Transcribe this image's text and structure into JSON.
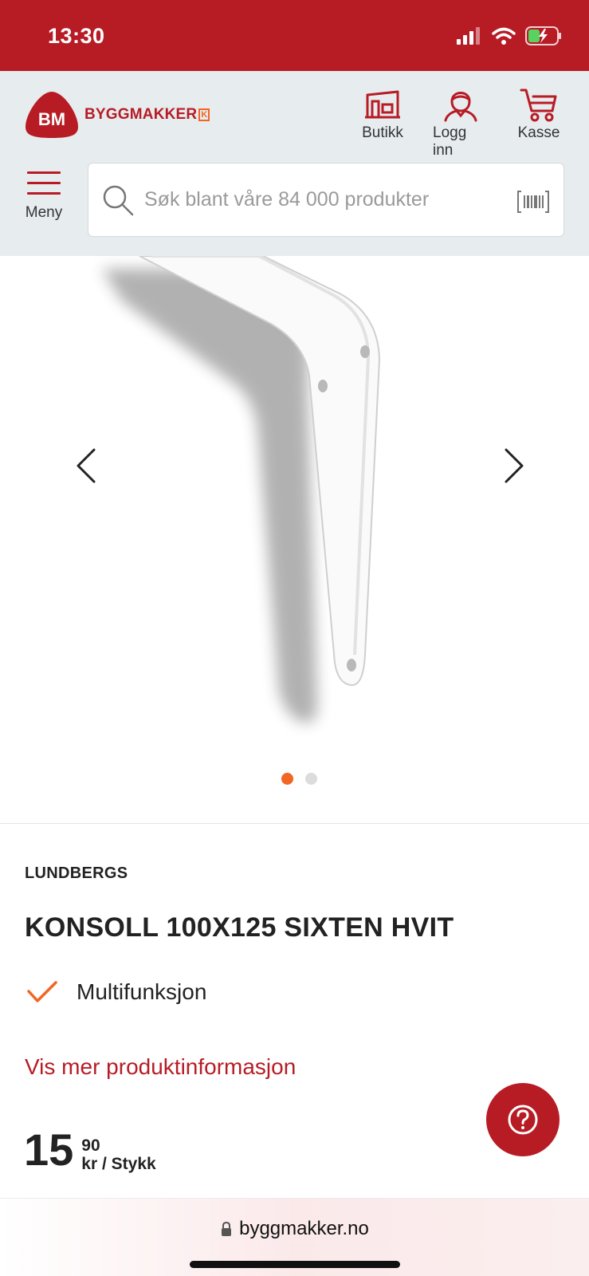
{
  "status_bar": {
    "time": "13:30"
  },
  "header": {
    "logo": {
      "badge": "BM",
      "text": "BYGGMAKKER",
      "suffix": "K"
    },
    "nav": [
      {
        "label": "Butikk",
        "icon": "store-icon"
      },
      {
        "label": "Logg inn",
        "icon": "user-icon"
      },
      {
        "label": "Kasse",
        "icon": "cart-icon"
      }
    ],
    "menu_label": "Meny",
    "search": {
      "placeholder": "Søk blant våre 84 000 produkter",
      "value": ""
    }
  },
  "gallery": {
    "image_count": 2,
    "active_index": 0
  },
  "product": {
    "brand": "LUNDBERGS",
    "title": "KONSOLL 100X125 SIXTEN HVIT",
    "features": [
      "Multifunksjon"
    ],
    "more_info_link": "Vis mer produktinformasjon",
    "price": {
      "main": "15",
      "decimals": "90",
      "unit": "kr / Stykk"
    }
  },
  "browser": {
    "url": "byggmakker.no"
  },
  "colors": {
    "brand_red": "#b71c25",
    "accent_orange": "#f26522",
    "header_bg": "#e7ecef"
  }
}
